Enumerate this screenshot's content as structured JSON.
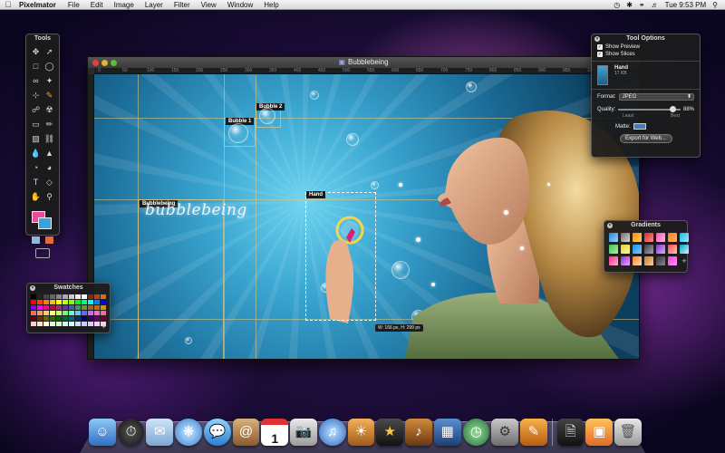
{
  "menubar": {
    "app_name": "Pixelmator",
    "menus": [
      "File",
      "Edit",
      "Image",
      "Layer",
      "Filter",
      "View",
      "Window",
      "Help"
    ],
    "clock": "Tue 9:53 PM"
  },
  "document": {
    "title": "Bubblebeing",
    "ruler_ticks": [
      "0",
      "50",
      "100",
      "150",
      "200",
      "250",
      "300",
      "350",
      "400",
      "450",
      "500",
      "550",
      "600",
      "650",
      "700",
      "750",
      "800",
      "850",
      "900",
      "950",
      "1000",
      "1050"
    ],
    "slices": {
      "bubblebeing": "Bubblebeing",
      "bubble1": "Bubble 1",
      "bubble2": "Bubble 2",
      "hand": "Hand"
    },
    "canvas_text": "bubblebeing",
    "selection_size": "W: 166 px, H: 299 px"
  },
  "tools_palette": {
    "title": "Tools"
  },
  "swatches_palette": {
    "title": "Swatches",
    "colors": [
      "#000000",
      "#222222",
      "#444444",
      "#666666",
      "#888888",
      "#aaaaaa",
      "#cccccc",
      "#eeeeee",
      "#ffffff",
      "#8a2b0f",
      "#b4441a",
      "#d96b1f",
      "#ff0000",
      "#ff4000",
      "#ff8000",
      "#ffbf00",
      "#ffff00",
      "#bfff00",
      "#80ff00",
      "#00ff00",
      "#00ff80",
      "#00ffff",
      "#0080ff",
      "#0000ff",
      "#8000ff",
      "#ff00ff",
      "#ff0080",
      "#cc0033",
      "#993366",
      "#663399",
      "#336699",
      "#339966",
      "#669933",
      "#996633",
      "#cc6600",
      "#cc9900",
      "#ff6666",
      "#ff9966",
      "#ffcc66",
      "#ffff66",
      "#ccff66",
      "#66ff66",
      "#66ffcc",
      "#66ccff",
      "#6666ff",
      "#cc66ff",
      "#ff66cc",
      "#ff6699",
      "#660000",
      "#663300",
      "#666600",
      "#336600",
      "#006600",
      "#006633",
      "#006666",
      "#003366",
      "#000066",
      "#330066",
      "#660066",
      "#660033",
      "#ffcccc",
      "#ffe0cc",
      "#ffffcc",
      "#e0ffcc",
      "#ccffcc",
      "#ccffe0",
      "#ccffff",
      "#cce0ff",
      "#ccccff",
      "#e0ccff",
      "#ffccff",
      "#ffcce0"
    ]
  },
  "tool_options": {
    "title": "Tool Options",
    "show_preview": "Show Preview",
    "show_slices": "Show Slices",
    "slice_name": "Hand",
    "slice_size": "17 KB",
    "format_label": "Format:",
    "format_value": "JPEG",
    "quality_label": "Quality:",
    "quality_value": "88%",
    "quality_fraction": 0.88,
    "quality_min": "Least",
    "quality_max": "Best",
    "matte_label": "Matte:",
    "export_button": "Export for Web..."
  },
  "gradients_palette": {
    "title": "Gradients",
    "swatches": [
      "linear-gradient(135deg,#2b7fd6,#9fd3ff)",
      "linear-gradient(135deg,#6b6b6b,#d8d8d8)",
      "linear-gradient(135deg,#ff8a00,#ffd36b)",
      "linear-gradient(135deg,#d82a2a,#ff8b8b)",
      "linear-gradient(135deg,#ff4fae,#ffc0e1)",
      "linear-gradient(135deg,#ff7a1a,#ffb56b)",
      "linear-gradient(135deg,#19b7e8,#9ce9ff)",
      "linear-gradient(135deg,#38c55a,#b4f0a0)",
      "linear-gradient(135deg,#e7d32f,#fff4a2)",
      "linear-gradient(135deg,#1f8de6,#79c7ff)",
      "linear-gradient(135deg,#3c3c3c,#a8a8a8)",
      "linear-gradient(135deg,#7a3cc9,#e6a3ff)",
      "linear-gradient(135deg,#ff3d5a,#ffd1b0)",
      "linear-gradient(135deg,#00a7c8,#d2f3ff)",
      "linear-gradient(135deg,#ff2a8c,#ffb0d6)",
      "linear-gradient(135deg,#9a2ad6,#e9a7ff)",
      "linear-gradient(135deg,#ff7f2a,#ffe0b0)",
      "linear-gradient(135deg,#c77a2a,#f1d4a3)",
      "linear-gradient(135deg,#333,#888)",
      "linear-gradient(135deg,#ff36d8,#ff9af0)"
    ],
    "add": "+"
  },
  "dock": {
    "icons": [
      "finder-icon",
      "dashboard-icon",
      "mail-icon",
      "safari-icon",
      "ichat-icon",
      "address-book-icon",
      "ical-icon",
      "preview-icon",
      "itunes-icon",
      "iphoto-icon",
      "imovie-icon",
      "garageband-icon",
      "spaces-icon",
      "time-machine-icon",
      "system-preferences-icon",
      "pixelmator-icon",
      "documents-stack-icon",
      "pictures-stack-icon",
      "trash-icon"
    ],
    "calendar_day": "1"
  },
  "colors": {
    "tool_accent": "#f7a32b",
    "foreground_color": "#e94b98",
    "background_color": "#36a3df"
  }
}
